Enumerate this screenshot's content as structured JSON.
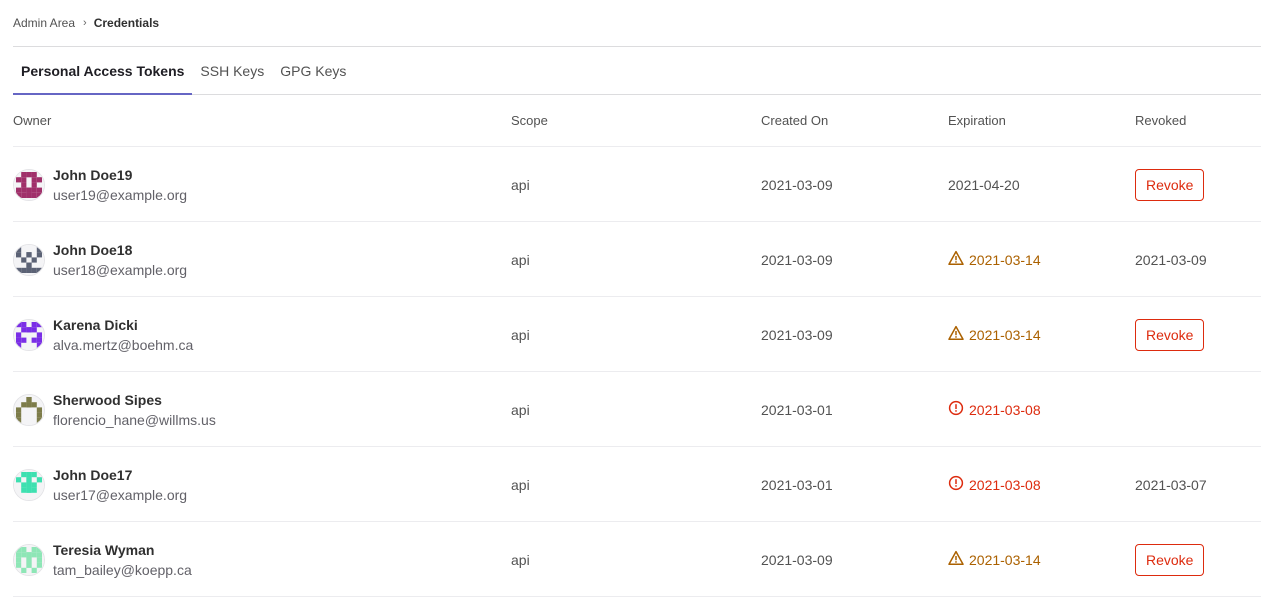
{
  "breadcrumb": {
    "parent": "Admin Area",
    "separator": "›",
    "current": "Credentials"
  },
  "tabs": [
    {
      "label": "Personal Access Tokens",
      "active": true
    },
    {
      "label": "SSH Keys",
      "active": false
    },
    {
      "label": "GPG Keys",
      "active": false
    }
  ],
  "table": {
    "headers": {
      "owner": "Owner",
      "scope": "Scope",
      "created": "Created On",
      "expiration": "Expiration",
      "revoked": "Revoked"
    },
    "revoke_label": "Revoke",
    "rows": [
      {
        "name": "John Doe19",
        "email": "user19@example.org",
        "scope": "api",
        "created": "2021-03-09",
        "expiration": "2021-04-20",
        "expiration_status": "normal",
        "expiration_icon": "",
        "revoked": "",
        "show_revoke": true,
        "avatar_color": "#a0306a",
        "avatar_icon": "identicon-avatar"
      },
      {
        "name": "John Doe18",
        "email": "user18@example.org",
        "scope": "api",
        "created": "2021-03-09",
        "expiration": "2021-03-14",
        "expiration_status": "warning",
        "expiration_icon": "warning-icon",
        "revoked": "2021-03-09",
        "show_revoke": false,
        "avatar_color": "#5b6275",
        "avatar_icon": "identicon-avatar"
      },
      {
        "name": "Karena Dicki",
        "email": "alva.mertz@boehm.ca",
        "scope": "api",
        "created": "2021-03-09",
        "expiration": "2021-03-14",
        "expiration_status": "warning",
        "expiration_icon": "warning-icon",
        "revoked": "",
        "show_revoke": true,
        "avatar_color": "#7a2ee6",
        "avatar_icon": "identicon-avatar"
      },
      {
        "name": "Sherwood Sipes",
        "email": "florencio_hane@willms.us",
        "scope": "api",
        "created": "2021-03-01",
        "expiration": "2021-03-08",
        "expiration_status": "danger",
        "expiration_icon": "error-icon",
        "revoked": "",
        "show_revoke": false,
        "avatar_color": "#7d7c4a",
        "avatar_icon": "identicon-avatar"
      },
      {
        "name": "John Doe17",
        "email": "user17@example.org",
        "scope": "api",
        "created": "2021-03-01",
        "expiration": "2021-03-08",
        "expiration_status": "danger",
        "expiration_icon": "error-icon",
        "revoked": "2021-03-07",
        "show_revoke": false,
        "avatar_color": "#3de0b0",
        "avatar_icon": "identicon-avatar"
      },
      {
        "name": "Teresia Wyman",
        "email": "tam_bailey@koepp.ca",
        "scope": "api",
        "created": "2021-03-09",
        "expiration": "2021-03-14",
        "expiration_status": "warning",
        "expiration_icon": "warning-icon",
        "revoked": "",
        "show_revoke": true,
        "avatar_color": "#8ee6b6",
        "avatar_icon": "identicon-avatar"
      }
    ]
  }
}
